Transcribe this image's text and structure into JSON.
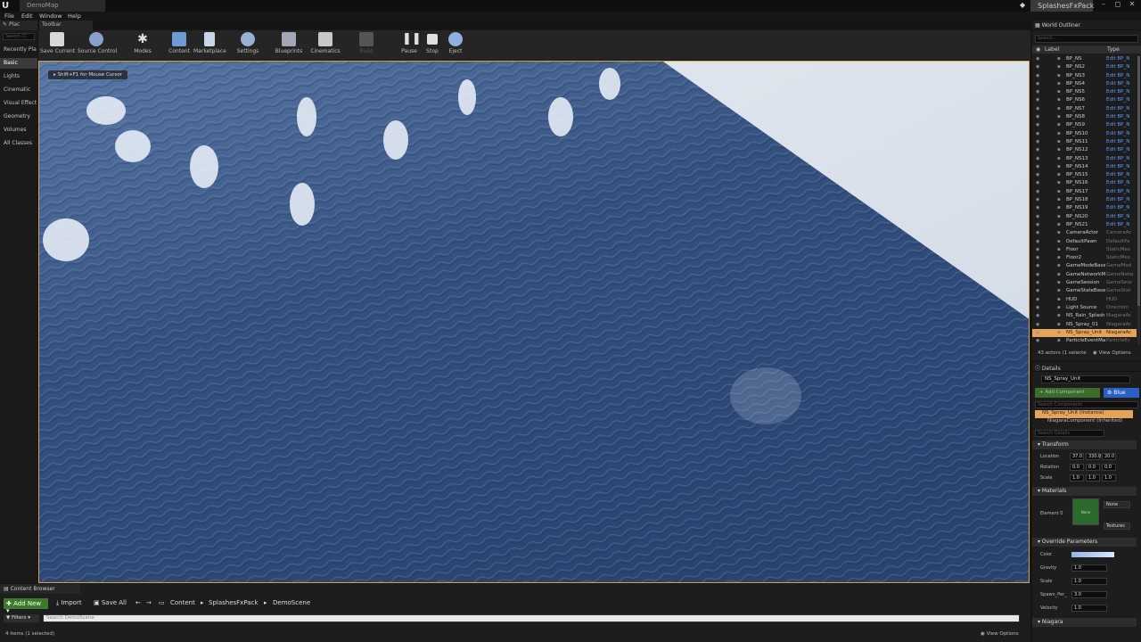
{
  "window": {
    "logo": "U",
    "map_tab": "DemoMap",
    "project_name": "SplashesFxPack",
    "minimize": "–",
    "maximize": "◻",
    "close": "✕"
  },
  "menu": [
    "File",
    "Edit",
    "Window",
    "Help"
  ],
  "modes_panel": {
    "tab": "Plac",
    "search_placeholder": "Search Cl",
    "categories": [
      "Recently Pla",
      "Basic",
      "Lights",
      "Cinematic",
      "Visual Effect",
      "Geometry",
      "Volumes",
      "All Classes"
    ],
    "active_category": "Basic"
  },
  "toolbar": {
    "tab": "Toolbar",
    "buttons": [
      {
        "label": "Save Current",
        "icon": "save-icon",
        "color": "#d8d8d8"
      },
      {
        "label": "Source Control",
        "icon": "source-control-icon",
        "color": "#8aa0c8"
      },
      {
        "label": "Modes",
        "icon": "modes-icon",
        "color": "#cccccc"
      },
      {
        "label": "Content",
        "icon": "content-icon",
        "color": "#6f9ad8"
      },
      {
        "label": "Marketplace",
        "icon": "marketplace-icon",
        "color": "#c9d6ea"
      },
      {
        "label": "Settings",
        "icon": "settings-icon",
        "color": "#9ab0d0"
      },
      {
        "label": "Blueprints",
        "icon": "blueprints-icon",
        "color": "#a0a8b8"
      },
      {
        "label": "Cinematics",
        "icon": "cinematics-icon",
        "color": "#c8c8c8"
      },
      {
        "label": "Build",
        "icon": "build-icon",
        "color": "#555555"
      },
      {
        "label": "Pause",
        "icon": "pause-icon",
        "color": "#e0e0e0"
      },
      {
        "label": "Stop",
        "icon": "stop-icon",
        "color": "#e0e0e0"
      },
      {
        "label": "Eject",
        "icon": "eject-icon",
        "color": "#8fb0e0"
      }
    ]
  },
  "viewport": {
    "hint": "Shift+F1 for Mouse Cursor"
  },
  "outliner": {
    "tab": "World Outliner",
    "search_placeholder": "Search...",
    "col_label": "Label",
    "col_type": "Type",
    "rows": [
      {
        "label": "BP_NS",
        "type": "Edit BP_N",
        "link": true
      },
      {
        "label": "BP_NS2",
        "type": "Edit BP_N",
        "link": true
      },
      {
        "label": "BP_NS3",
        "type": "Edit BP_N",
        "link": true
      },
      {
        "label": "BP_NS4",
        "type": "Edit BP_N",
        "link": true
      },
      {
        "label": "BP_NS5",
        "type": "Edit BP_N",
        "link": true
      },
      {
        "label": "BP_NS6",
        "type": "Edit BP_N",
        "link": true
      },
      {
        "label": "BP_NS7",
        "type": "Edit BP_N",
        "link": true
      },
      {
        "label": "BP_NS8",
        "type": "Edit BP_N",
        "link": true
      },
      {
        "label": "BP_NS9",
        "type": "Edit BP_N",
        "link": true
      },
      {
        "label": "BP_NS10",
        "type": "Edit BP_N",
        "link": true
      },
      {
        "label": "BP_NS11",
        "type": "Edit BP_N",
        "link": true
      },
      {
        "label": "BP_NS12",
        "type": "Edit BP_N",
        "link": true
      },
      {
        "label": "BP_NS13",
        "type": "Edit BP_N",
        "link": true
      },
      {
        "label": "BP_NS14",
        "type": "Edit BP_N",
        "link": true
      },
      {
        "label": "BP_NS15",
        "type": "Edit BP_N",
        "link": true
      },
      {
        "label": "BP_NS16",
        "type": "Edit BP_N",
        "link": true
      },
      {
        "label": "BP_NS17",
        "type": "Edit BP_N",
        "link": true
      },
      {
        "label": "BP_NS18",
        "type": "Edit BP_N",
        "link": true
      },
      {
        "label": "BP_NS19",
        "type": "Edit BP_N",
        "link": true
      },
      {
        "label": "BP_NS20",
        "type": "Edit BP_N",
        "link": true
      },
      {
        "label": "BP_NS21",
        "type": "Edit BP_N",
        "link": true
      },
      {
        "label": "CameraActor",
        "type": "CameraAc",
        "link": false
      },
      {
        "label": "DefaultPawn",
        "type": "DefaultPa",
        "link": false
      },
      {
        "label": "Floor",
        "type": "StaticMes",
        "link": false
      },
      {
        "label": "Floor2",
        "type": "StaticMes",
        "link": false
      },
      {
        "label": "GameModeBase",
        "type": "GameMod",
        "link": false
      },
      {
        "label": "GameNetworkMa",
        "type": "GameNetw",
        "link": false
      },
      {
        "label": "GameSession",
        "type": "GameSess",
        "link": false
      },
      {
        "label": "GameStateBase",
        "type": "GameStat",
        "link": false
      },
      {
        "label": "HUD",
        "type": "HUD",
        "link": false
      },
      {
        "label": "Light Source",
        "type": "Direction",
        "link": false
      },
      {
        "label": "NS_Rain_Splash",
        "type": "NiagaraAc",
        "link": false
      },
      {
        "label": "NS_Spray_01",
        "type": "NiagaraAc",
        "link": false
      },
      {
        "label": "NS_Spray_Unit",
        "type": "NiagaraAc",
        "link": false,
        "selected": true
      },
      {
        "label": "ParticleEventMa",
        "type": "ParticleEv",
        "link": false
      }
    ],
    "footer_count": "43 actors (1 selecte",
    "footer_view_options": "View Options"
  },
  "details": {
    "tab": "Details",
    "actor_name": "NS_Spray_Unit",
    "add_component": "+ Add Component",
    "blueprint_btn": "Blue",
    "components_search_placeholder": "Search Components",
    "component_selected": "NS_Spray_Unit (Instance)",
    "component_child": "NiagaraComponent (Inherited)",
    "details_search_placeholder": "Search Details",
    "transform": {
      "title": "Transform",
      "location_label": "Location",
      "rotation_label": "Rotation",
      "scale_label": "Scale",
      "location": [
        "37.0",
        "330.0",
        "20.0"
      ],
      "rotation": [
        "0.0",
        "0.0",
        "0.0"
      ],
      "scale": [
        "1.0",
        "1.0",
        "1.0"
      ]
    },
    "materials": {
      "title": "Materials",
      "element_label": "Element 0",
      "swatch_text": "None",
      "dropdown": "None",
      "textures": "Textures"
    },
    "override": {
      "title": "Override Parameters",
      "color_label": "Color",
      "gravity_label": "Gravity",
      "gravity": "1.0",
      "scale_label": "Scale",
      "scale": "1.0",
      "spawn_label": "Spawn_Per_",
      "spawn": "3.0",
      "velocity_label": "Velocity",
      "velocity": "1.0"
    },
    "niagara_title": "Niagara"
  },
  "content_browser": {
    "tab": "Content Browser",
    "add_new": "Add New",
    "import": "Import",
    "save_all": "Save All",
    "breadcrumbs": [
      "Content",
      "SplashesFxPack",
      "DemoScene"
    ],
    "filters": "Filters",
    "search_placeholder": "Search DemoScene",
    "status": "4 items (1 selected)",
    "view_options": "View Options"
  }
}
